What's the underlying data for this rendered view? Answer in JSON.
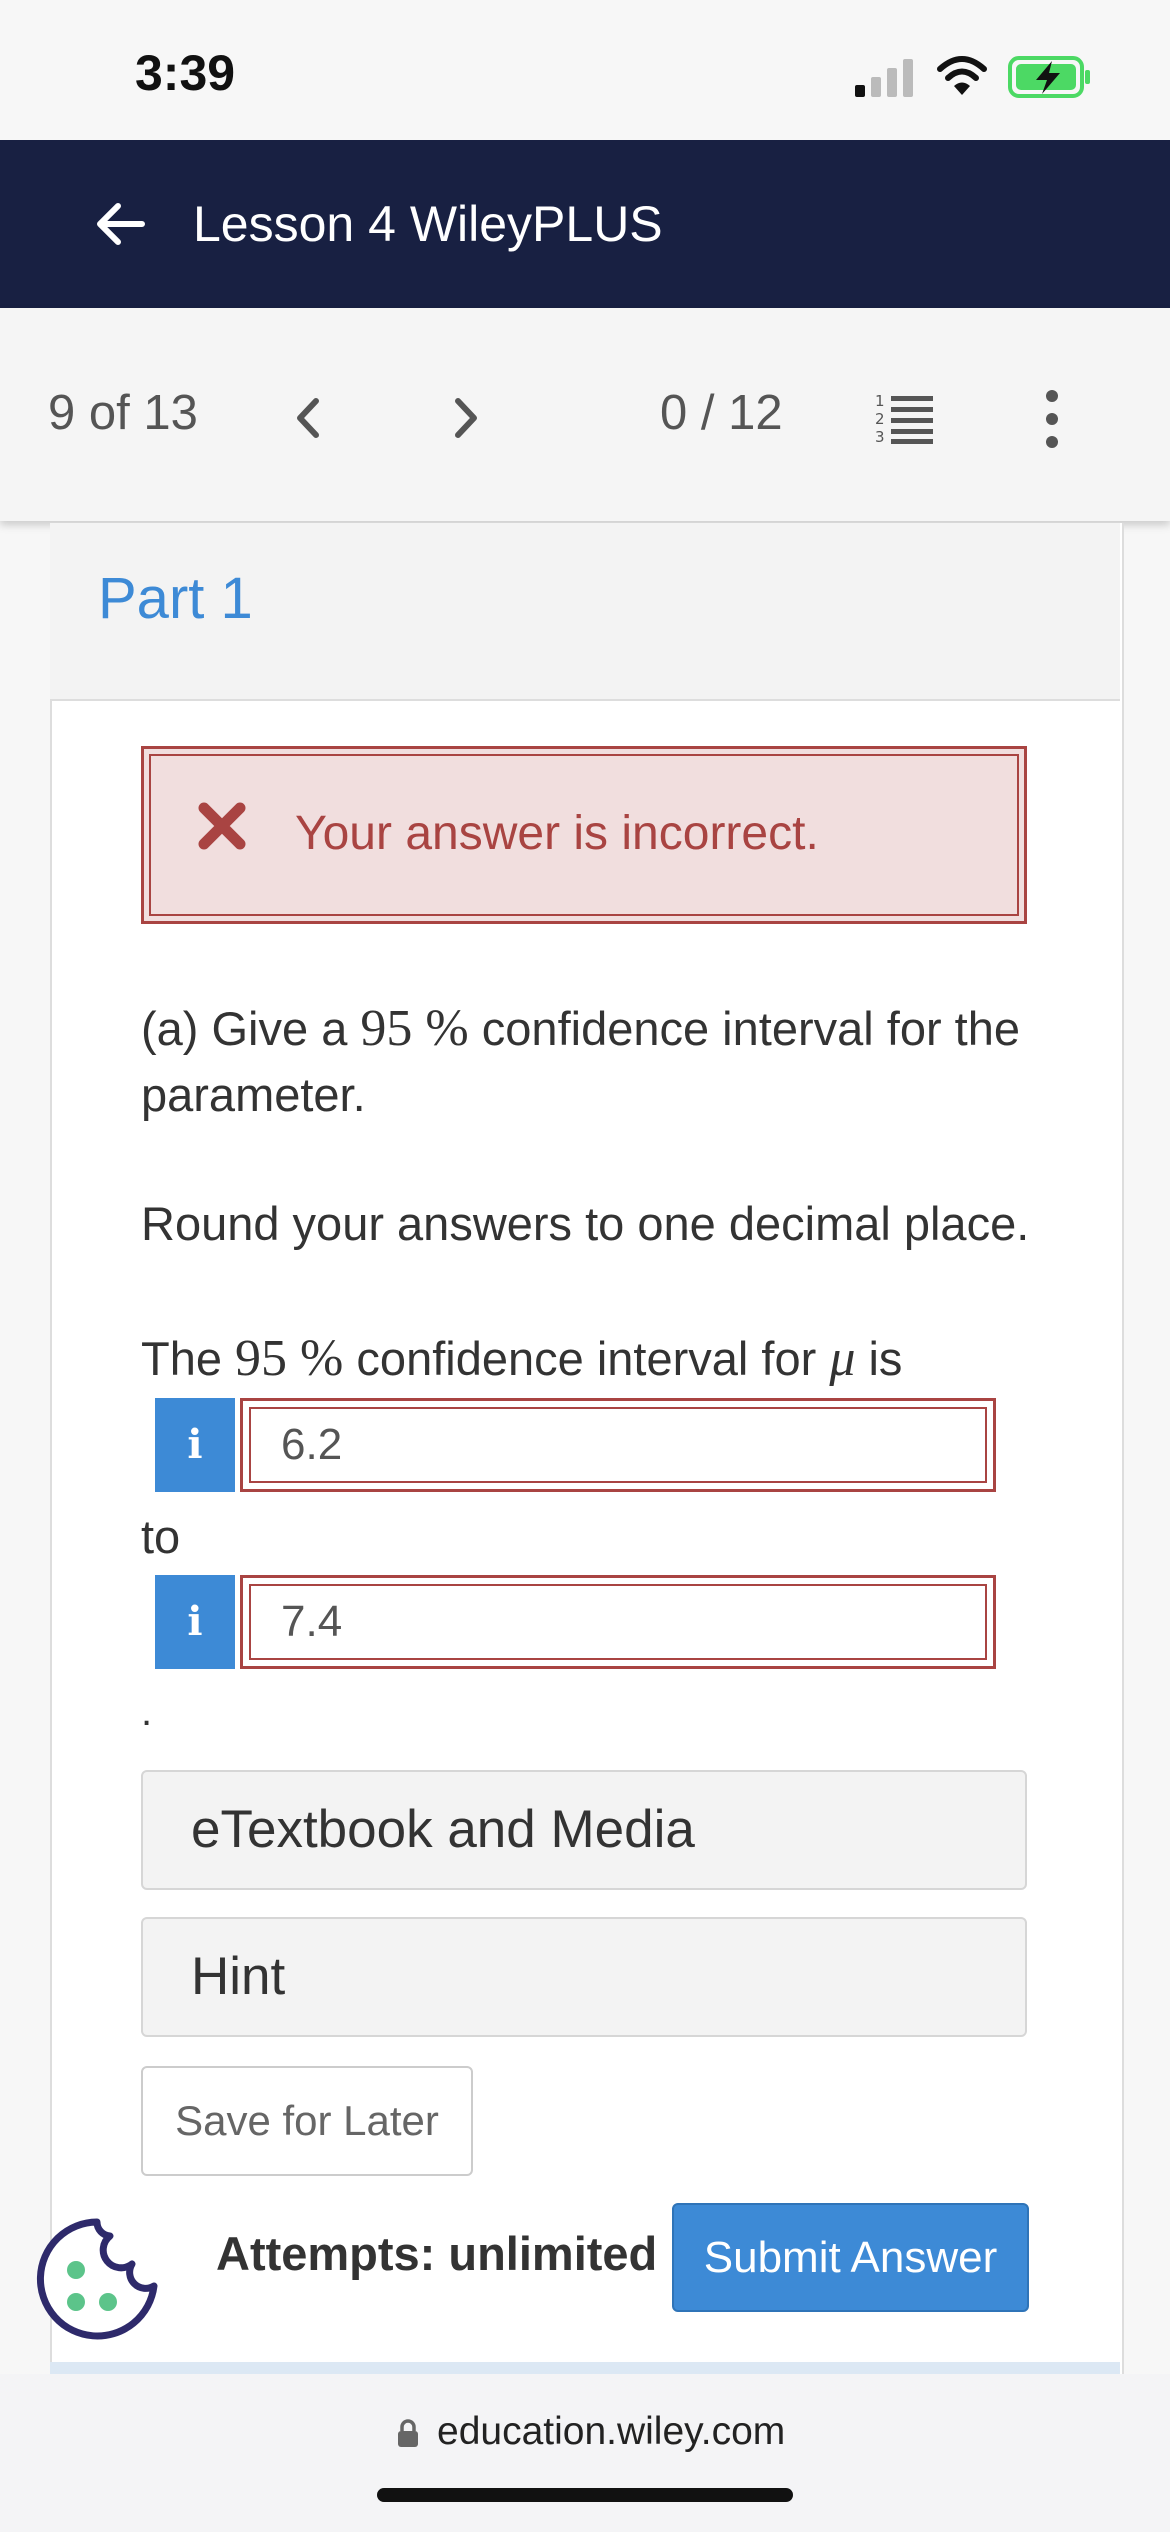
{
  "status_bar": {
    "time": "3:39"
  },
  "header": {
    "title": "Lesson 4 WileyPLUS"
  },
  "nav": {
    "position": "9 of 13",
    "score": "0 / 12"
  },
  "part": {
    "title": "Part 1"
  },
  "feedback": {
    "message": "Your answer is incorrect."
  },
  "question": {
    "line1_prefix": "(a) Give a ",
    "line1_math": "95 %",
    "line1_suffix": " confidence interval for the parameter.",
    "round_instruction": "Round your answers to one decimal place.",
    "ci_prefix": "The ",
    "ci_math": "95 %",
    "ci_middle": " confidence interval for ",
    "ci_symbol": "μ",
    "ci_suffix": " is",
    "to_label": "to",
    "period": "."
  },
  "answers": {
    "lower": {
      "value": "6.2",
      "info_label": "i"
    },
    "upper": {
      "value": "7.4",
      "info_label": "i"
    }
  },
  "resources": {
    "etextbook_label": "eTextbook and Media",
    "hint_label": "Hint"
  },
  "actions": {
    "save_label": "Save for Later",
    "attempts_label": "Attempts: unlimited",
    "submit_label": "Submit Answer"
  },
  "browser": {
    "url": "education.wiley.com"
  },
  "colors": {
    "header_bg": "#182042",
    "accent_blue": "#3d8ad6",
    "error_red": "#a94442",
    "error_bg": "#f1dede",
    "cookie_green": "#5cc48a",
    "cookie_outline": "#2e2a6b",
    "battery_green": "#4cd964"
  },
  "icons": [
    "back-arrow-icon",
    "chevron-left-icon",
    "chevron-right-icon",
    "numbered-list-icon",
    "more-vertical-icon",
    "x-mark-icon",
    "info-icon",
    "cookie-icon",
    "lock-icon",
    "signal-icon",
    "wifi-icon",
    "battery-charging-icon"
  ]
}
